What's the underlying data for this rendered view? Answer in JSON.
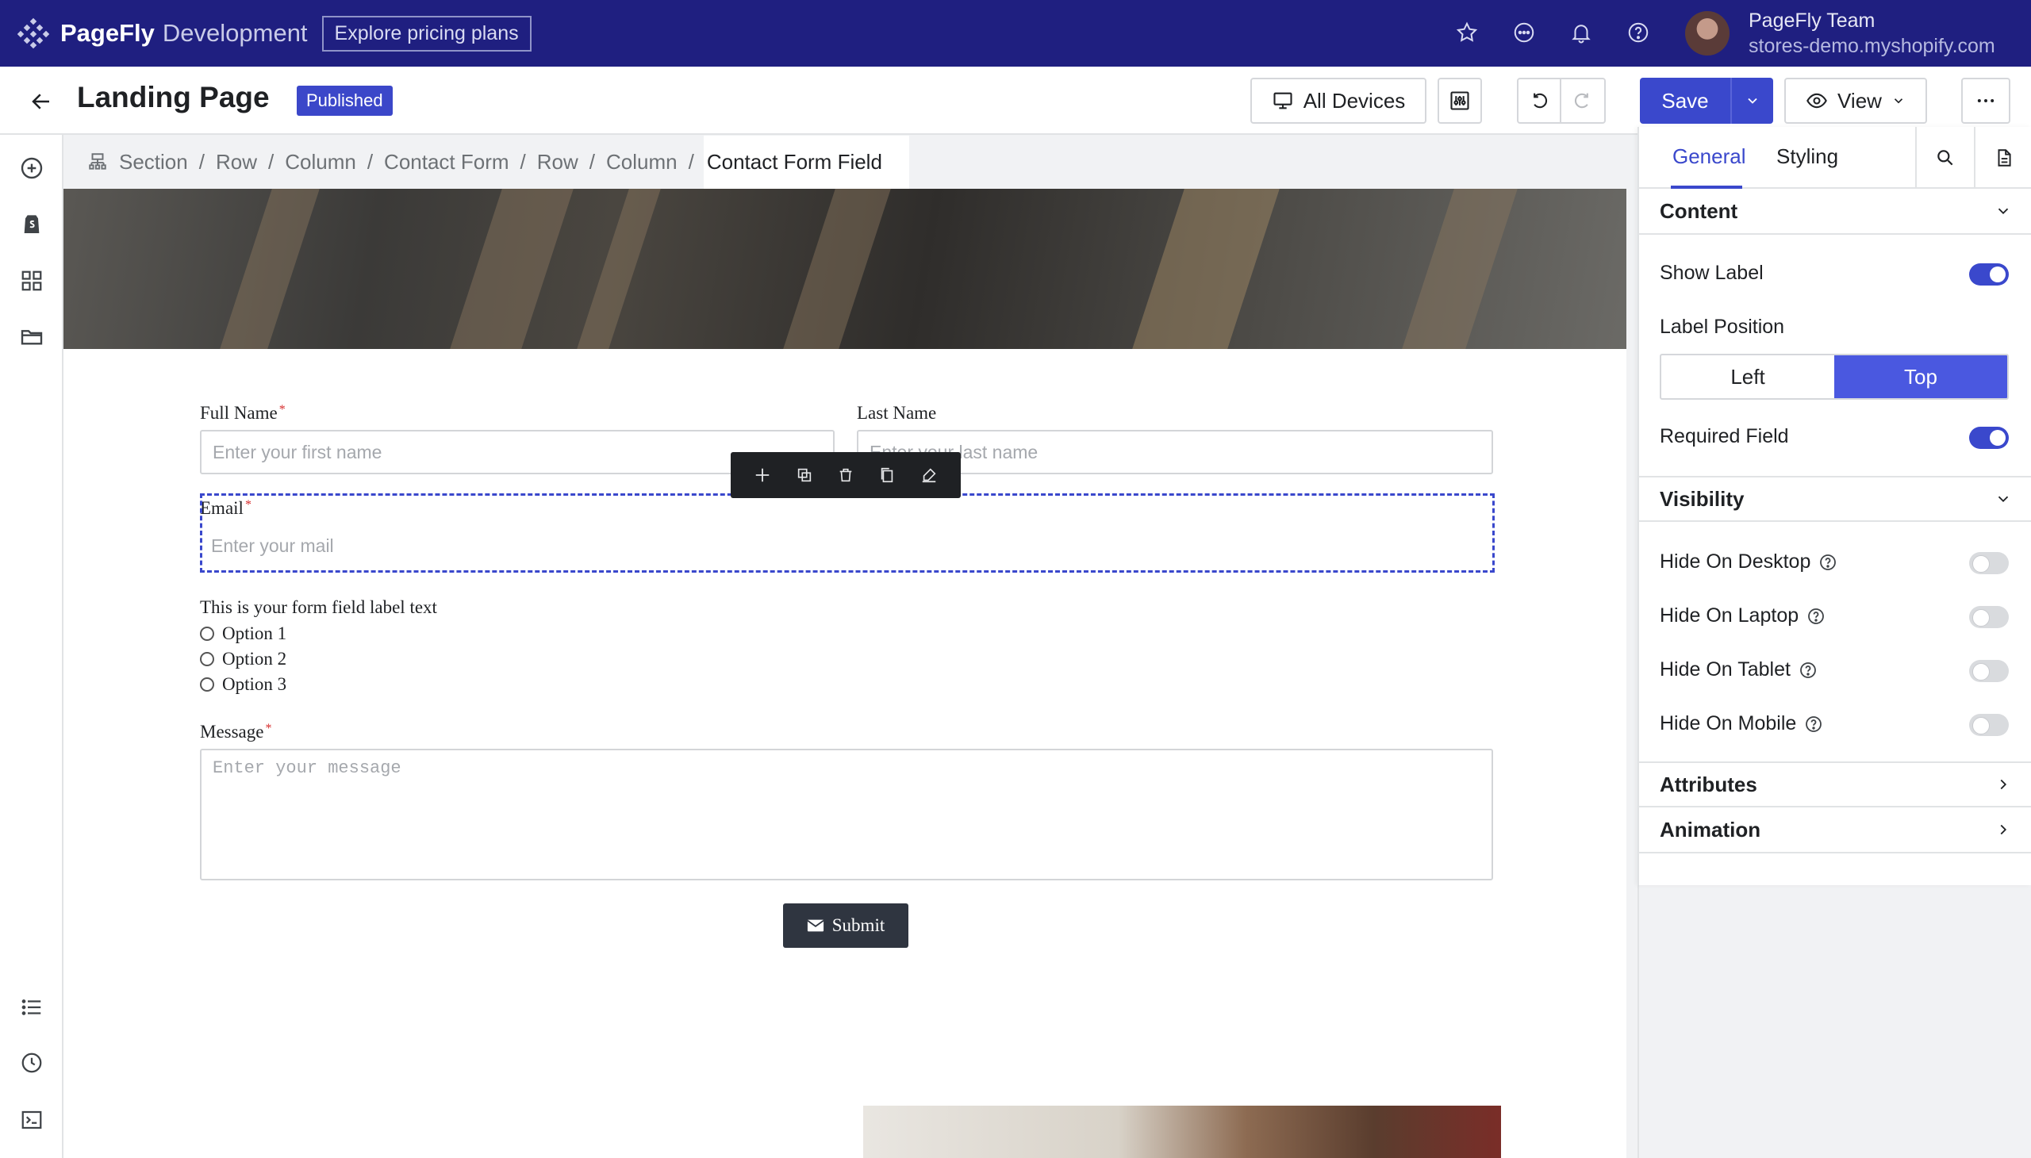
{
  "topbar": {
    "brand_strong": "PageFly",
    "brand_light": "Development",
    "pricing_label": "Explore pricing plans",
    "team_name": "PageFly Team",
    "store_domain": "stores-demo.myshopify.com"
  },
  "header": {
    "page_title": "Landing Page",
    "status_badge": "Published",
    "devices_label": "All Devices",
    "save_label": "Save",
    "view_label": "View"
  },
  "breadcrumb": [
    "Section",
    "Row",
    "Column",
    "Contact Form",
    "Row",
    "Column",
    "Contact Form Field"
  ],
  "form": {
    "full_name_label": "Full Name",
    "full_name_placeholder": "Enter your first name",
    "last_name_label": "Last Name",
    "last_name_placeholder": "Enter your last name",
    "email_label": "Email",
    "email_placeholder": "Enter your mail",
    "radio_group_label": "This is your form field label text",
    "radio_options": [
      "Option 1",
      "Option 2",
      "Option 3"
    ],
    "message_label": "Message",
    "message_placeholder": "Enter your message",
    "submit_label": "Submit",
    "required_marker": "*"
  },
  "panel": {
    "tabs": [
      "General",
      "Styling"
    ],
    "content_section": "Content",
    "show_label": "Show Label",
    "show_label_on": true,
    "label_position": "Label Position",
    "position_options": [
      "Left",
      "Top"
    ],
    "position_selected": "Top",
    "required_field": "Required Field",
    "required_field_on": true,
    "visibility_section": "Visibility",
    "visibility_items": [
      {
        "label": "Hide On Desktop",
        "on": false
      },
      {
        "label": "Hide On Laptop",
        "on": false
      },
      {
        "label": "Hide On Tablet",
        "on": false
      },
      {
        "label": "Hide On Mobile",
        "on": false
      }
    ],
    "attributes_section": "Attributes",
    "animation_section": "Animation"
  },
  "colors": {
    "topbar_bg": "#1f1f80",
    "accent": "#3a48cc",
    "required": "#d62b2b"
  },
  "icons": {
    "topbar": [
      "star-icon",
      "chat-icon",
      "bell-icon",
      "help-icon"
    ],
    "rail_top": [
      "add-element-icon",
      "shopify-icon",
      "grid-icon",
      "folder-icon"
    ],
    "rail_bottom": [
      "list-icon",
      "history-icon",
      "console-icon"
    ],
    "toolbar": [
      "move-icon",
      "duplicate-icon",
      "delete-icon",
      "copy-icon",
      "style-brush-icon"
    ]
  }
}
